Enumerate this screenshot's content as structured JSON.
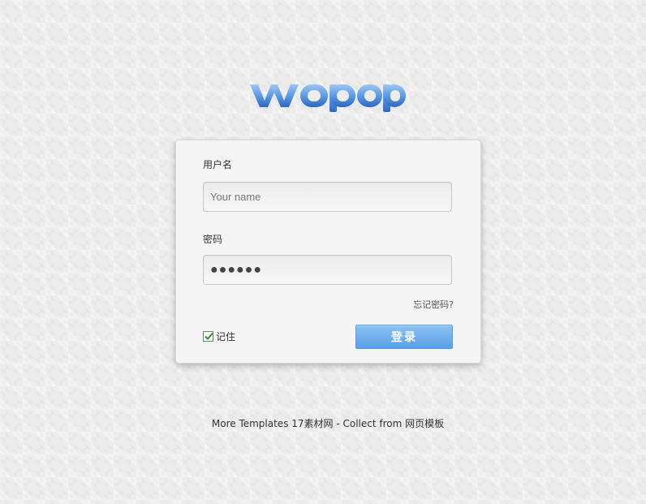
{
  "logo": {
    "text": "wopop",
    "colors": [
      "#7fb3ea",
      "#2f6fc8"
    ]
  },
  "login": {
    "username_label": "用户名",
    "username_placeholder": "Your name",
    "password_label": "密码",
    "password_value": "●●●●●●",
    "forgot_link": "忘记密码?",
    "remember_label": "记住",
    "remember_checked": true,
    "submit_label": "登录"
  },
  "footer": {
    "text": "More Templates 17素材网 - Collect from 网页模板"
  },
  "colors": {
    "button_top": "#8cc2f3",
    "button_bottom": "#5a9fe6",
    "checkbox_check": "#2e8b3a"
  }
}
